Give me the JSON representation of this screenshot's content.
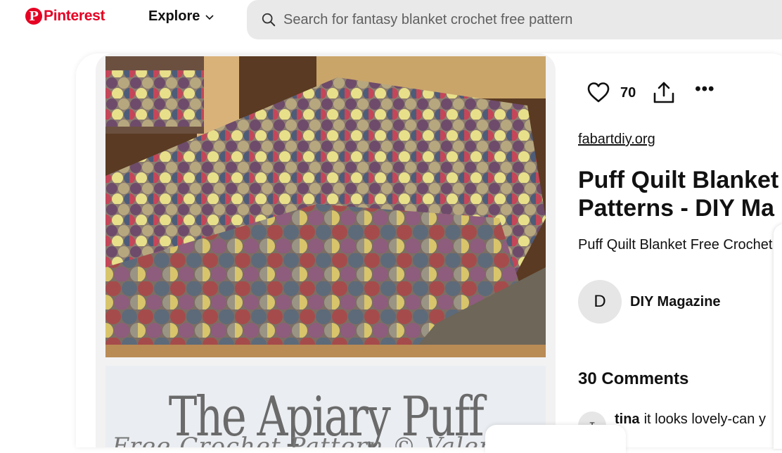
{
  "header": {
    "logo_text": "Pinterest",
    "logo_mark": "P",
    "explore_label": "Explore",
    "search_placeholder": "Search for fantasy blanket crochet free pattern"
  },
  "pin": {
    "image_banner_title": "The Apiary Puff",
    "image_banner_subtitle": "Free Crochet Pattern © Valerie L",
    "like_count": "70",
    "source": "fabartdiy.org",
    "title_line1": "Puff Quilt Blanket",
    "title_line2": "Patterns - DIY Ma",
    "description": "Puff Quilt Blanket Free Crochet",
    "creator_initial": "D",
    "creator_name": "DIY Magazine"
  },
  "comments": {
    "title": "30 Comments",
    "items": [
      {
        "initial": "T",
        "author": "tina",
        "text": "it looks lovely-can y"
      }
    ]
  },
  "icons": [
    "pinterest-logo-icon",
    "chevron-down-icon",
    "search-icon",
    "heart-icon",
    "share-icon",
    "more-icon"
  ],
  "colors": {
    "brand": "#e60023",
    "search_bg": "#e9e9e9",
    "avatar_bg": "#e6e6e6"
  }
}
